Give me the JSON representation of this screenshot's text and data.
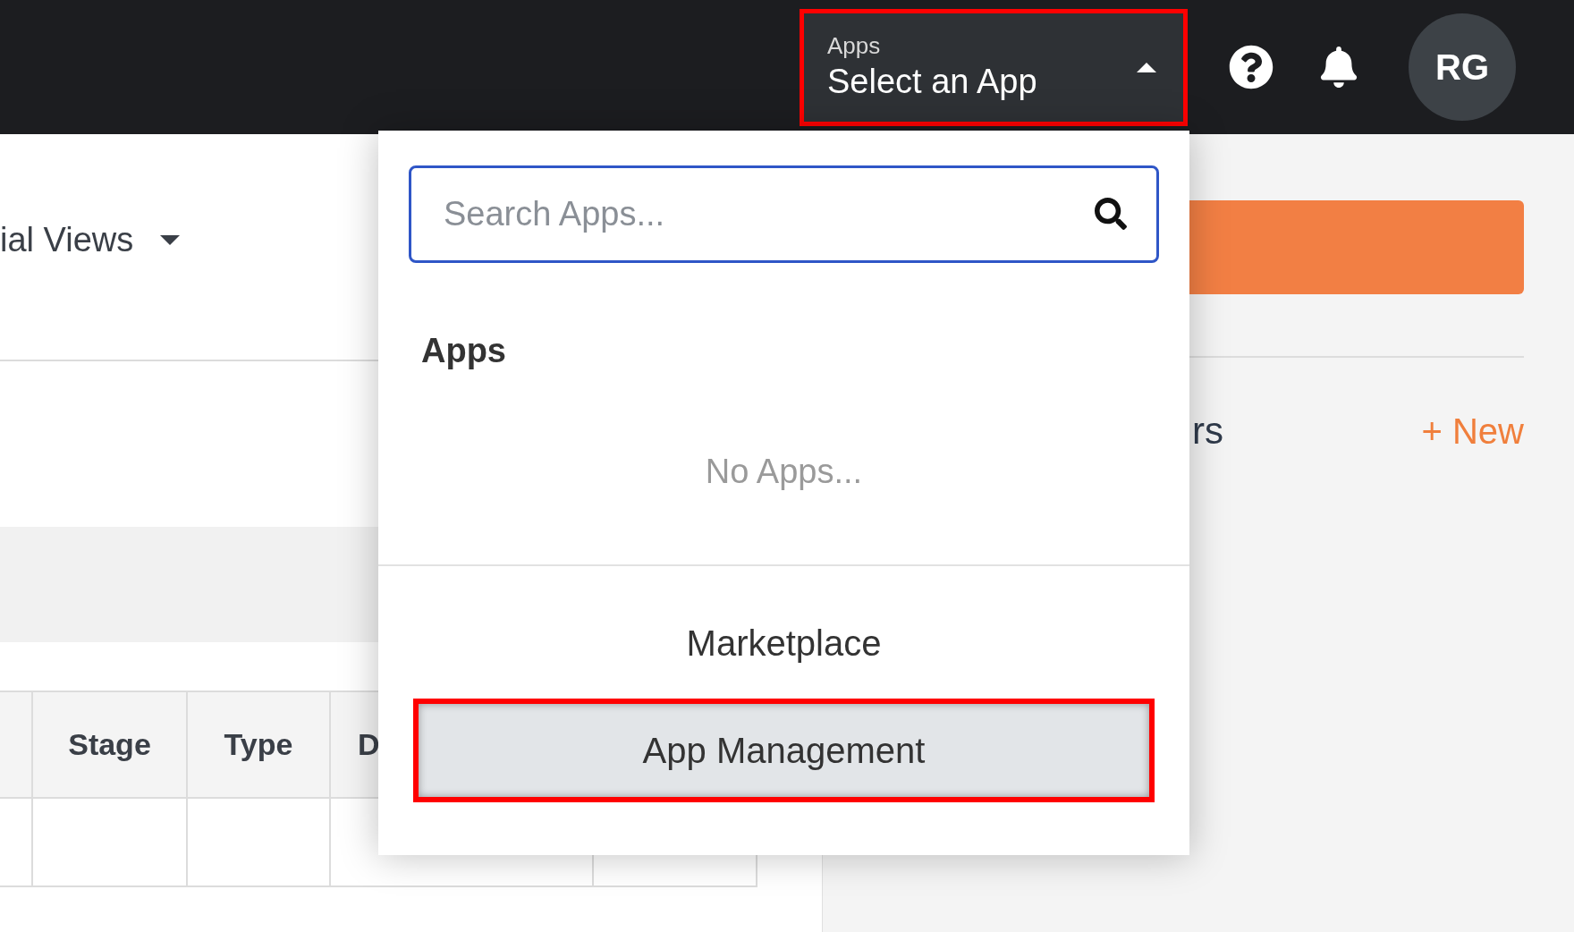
{
  "top_bar": {
    "app_selector": {
      "label": "Apps",
      "value": "Select an App",
      "expanded": true,
      "highlighted": true
    },
    "avatar_initials": "RG"
  },
  "views_menu": {
    "label": "ial Views"
  },
  "table": {
    "columns": [
      {
        "label": "Stage"
      },
      {
        "label": "Type"
      },
      {
        "label": "D"
      }
    ]
  },
  "side_panel": {
    "heading": "rs",
    "new_link": "+ New"
  },
  "app_menu": {
    "search": {
      "placeholder": "Search Apps..."
    },
    "section_title": "Apps",
    "empty_text": "No Apps...",
    "items": [
      {
        "label": "Marketplace",
        "highlighted": false
      },
      {
        "label": "App Management",
        "highlighted": true
      }
    ]
  }
}
